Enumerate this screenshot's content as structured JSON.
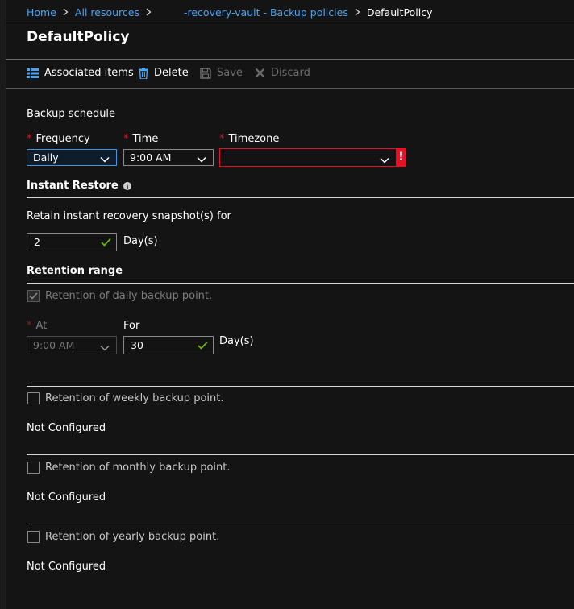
{
  "breadcrumb": {
    "items": [
      "Home",
      "All resources",
      "-recovery-vault - Backup policies"
    ],
    "current": "DefaultPolicy"
  },
  "page": {
    "title": "DefaultPolicy"
  },
  "toolbar": {
    "associated_items": "Associated items",
    "delete": "Delete",
    "save": "Save",
    "discard": "Discard"
  },
  "backup_schedule": {
    "heading": "Backup schedule",
    "frequency_label": "Frequency",
    "frequency_value": "Daily",
    "time_label": "Time",
    "time_value": "9:00 AM",
    "timezone_label": "Timezone",
    "timezone_value": "",
    "required_marker": "*",
    "error_marker": "!"
  },
  "instant_restore": {
    "heading": "Instant Restore",
    "retain_label": "Retain instant recovery snapshot(s) for",
    "retain_value": "2",
    "unit": "Day(s)"
  },
  "retention_range": {
    "heading": "Retention range",
    "daily": {
      "label": "Retention of daily backup point.",
      "checked": true,
      "at_label": "At",
      "at_value": "9:00 AM",
      "for_label": "For",
      "for_value": "30",
      "unit": "Day(s)"
    },
    "weekly": {
      "label": "Retention of weekly backup point.",
      "checked": false,
      "status": "Not Configured"
    },
    "monthly": {
      "label": "Retention of monthly backup point.",
      "checked": false,
      "status": "Not Configured"
    },
    "yearly": {
      "label": "Retention of yearly backup point.",
      "checked": false,
      "status": "Not Configured"
    }
  },
  "colors": {
    "accent_blue": "#4aa3f0",
    "error_red": "#e81123",
    "valid_green": "#6bb700",
    "background": "#141414"
  }
}
